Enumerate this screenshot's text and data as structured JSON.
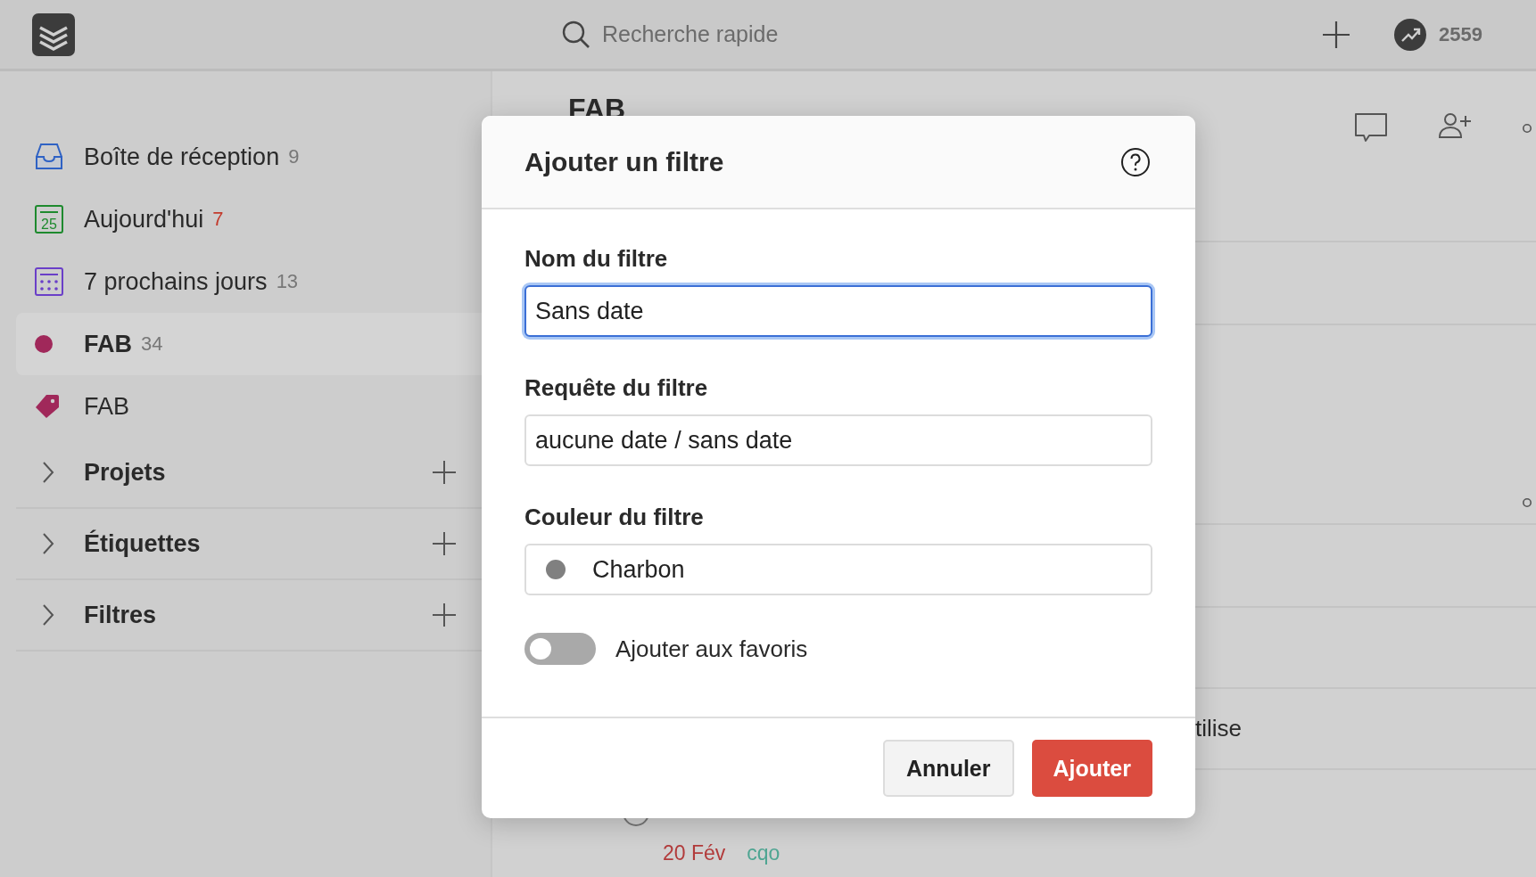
{
  "topbar": {
    "search": {
      "placeholder": "Recherche rapide"
    },
    "karma": "2559"
  },
  "sidebar": {
    "items": [
      {
        "kind": "inbox",
        "label": "Boîte de réception",
        "count": "9",
        "selected": false
      },
      {
        "kind": "today",
        "label": "Aujourd'hui",
        "count": "7",
        "selected": false,
        "icon_text": "25"
      },
      {
        "kind": "upcoming",
        "label": "7 prochains jours",
        "count": "13",
        "selected": false
      },
      {
        "kind": "project",
        "label": "FAB",
        "count": "34",
        "selected": true,
        "color": "#a0285a"
      },
      {
        "kind": "label",
        "label": "FAB",
        "selected": false,
        "color": "#a0285a"
      }
    ],
    "sections": [
      {
        "label": "Projets",
        "expanded": false
      },
      {
        "label": "Étiquettes",
        "expanded": false
      },
      {
        "label": "Filtres",
        "expanded": false
      }
    ]
  },
  "main": {
    "title": "FAB",
    "tasks": [
      {
        "text": "tilise"
      },
      {
        "due": "20 Fév",
        "tag": "cqo",
        "done": false
      }
    ]
  },
  "modal": {
    "title": "Ajouter un filtre",
    "fields": [
      {
        "label": "Nom du filtre",
        "value": "Sans date",
        "focused": true
      },
      {
        "label": "Requête du filtre",
        "value": "aucune date / sans date",
        "focused": false
      }
    ],
    "color_field": {
      "label": "Couleur du filtre",
      "value": "Charbon",
      "color": "#808080"
    },
    "favorite": {
      "label": "Ajouter aux favoris",
      "on": false
    },
    "buttons": [
      {
        "label": "Annuler",
        "kind": "secondary"
      },
      {
        "label": "Ajouter",
        "kind": "primary"
      }
    ]
  }
}
